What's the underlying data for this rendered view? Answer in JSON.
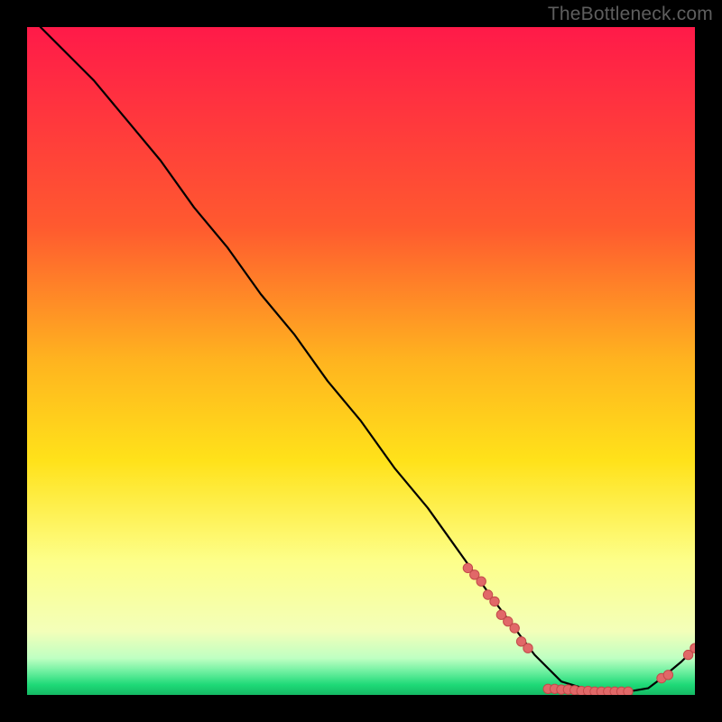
{
  "watermark": "TheBottleneck.com",
  "colors": {
    "frame": "#000000",
    "watermark": "#5e5e5e",
    "curve": "#000000",
    "marker_fill": "#e16868",
    "marker_stroke": "#c24a4a",
    "gradient_top": "#ff1a49",
    "gradient_mid_upper": "#ff8a2a",
    "gradient_mid": "#ffe21a",
    "gradient_mid_lower": "#f8ff66",
    "gradient_low": "#caffb0",
    "gradient_bottom": "#1ed977"
  },
  "chart_data": {
    "type": "line",
    "title": "",
    "xlabel": "",
    "ylabel": "",
    "xlim": [
      0,
      100
    ],
    "ylim": [
      0,
      100
    ],
    "curve": {
      "x": [
        2,
        5,
        8,
        10,
        15,
        20,
        25,
        30,
        35,
        40,
        45,
        50,
        55,
        60,
        65,
        70,
        73,
        76,
        80,
        85,
        90,
        93,
        95,
        98,
        100
      ],
      "y": [
        100,
        97,
        94,
        92,
        86,
        80,
        73,
        67,
        60,
        54,
        47,
        41,
        34,
        28,
        21,
        14,
        10,
        6,
        2,
        0.5,
        0.5,
        1,
        2.5,
        5,
        7
      ]
    },
    "markers": [
      {
        "x": 66,
        "y": 19
      },
      {
        "x": 67,
        "y": 18
      },
      {
        "x": 68,
        "y": 17
      },
      {
        "x": 69,
        "y": 15
      },
      {
        "x": 70,
        "y": 14
      },
      {
        "x": 71,
        "y": 12
      },
      {
        "x": 72,
        "y": 11
      },
      {
        "x": 73,
        "y": 10
      },
      {
        "x": 74,
        "y": 8
      },
      {
        "x": 75,
        "y": 7
      },
      {
        "x": 78,
        "y": 0.9
      },
      {
        "x": 79,
        "y": 0.9
      },
      {
        "x": 80,
        "y": 0.8
      },
      {
        "x": 81,
        "y": 0.8
      },
      {
        "x": 82,
        "y": 0.7
      },
      {
        "x": 83,
        "y": 0.6
      },
      {
        "x": 84,
        "y": 0.6
      },
      {
        "x": 85,
        "y": 0.5
      },
      {
        "x": 86,
        "y": 0.5
      },
      {
        "x": 87,
        "y": 0.5
      },
      {
        "x": 88,
        "y": 0.5
      },
      {
        "x": 89,
        "y": 0.5
      },
      {
        "x": 90,
        "y": 0.5
      },
      {
        "x": 95,
        "y": 2.5
      },
      {
        "x": 96,
        "y": 3
      },
      {
        "x": 99,
        "y": 6
      },
      {
        "x": 100,
        "y": 7
      }
    ]
  }
}
